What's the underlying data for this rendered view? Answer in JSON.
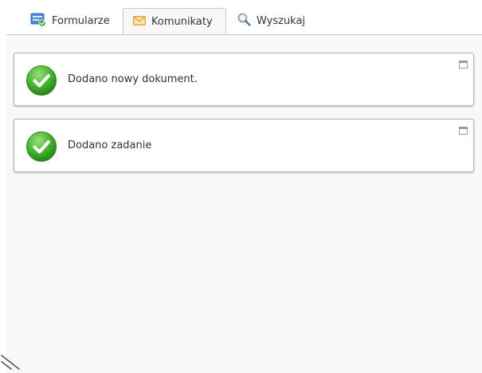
{
  "tabs": {
    "forms": {
      "label": "Formularze",
      "icon": "form-icon"
    },
    "messages": {
      "label": "Komunikaty",
      "icon": "envelope-icon",
      "active": true
    },
    "search": {
      "label": "Wyszukaj",
      "icon": "search-icon"
    }
  },
  "messages": [
    {
      "text": "Dodano nowy dokument.",
      "status": "success",
      "icon": "success-check-icon"
    },
    {
      "text": "Dodano zadanie",
      "status": "success",
      "icon": "success-check-icon"
    }
  ],
  "colors": {
    "success": "#3fae2a",
    "envelope": "#f1b53d",
    "form_icon": "#4f8bd6"
  }
}
